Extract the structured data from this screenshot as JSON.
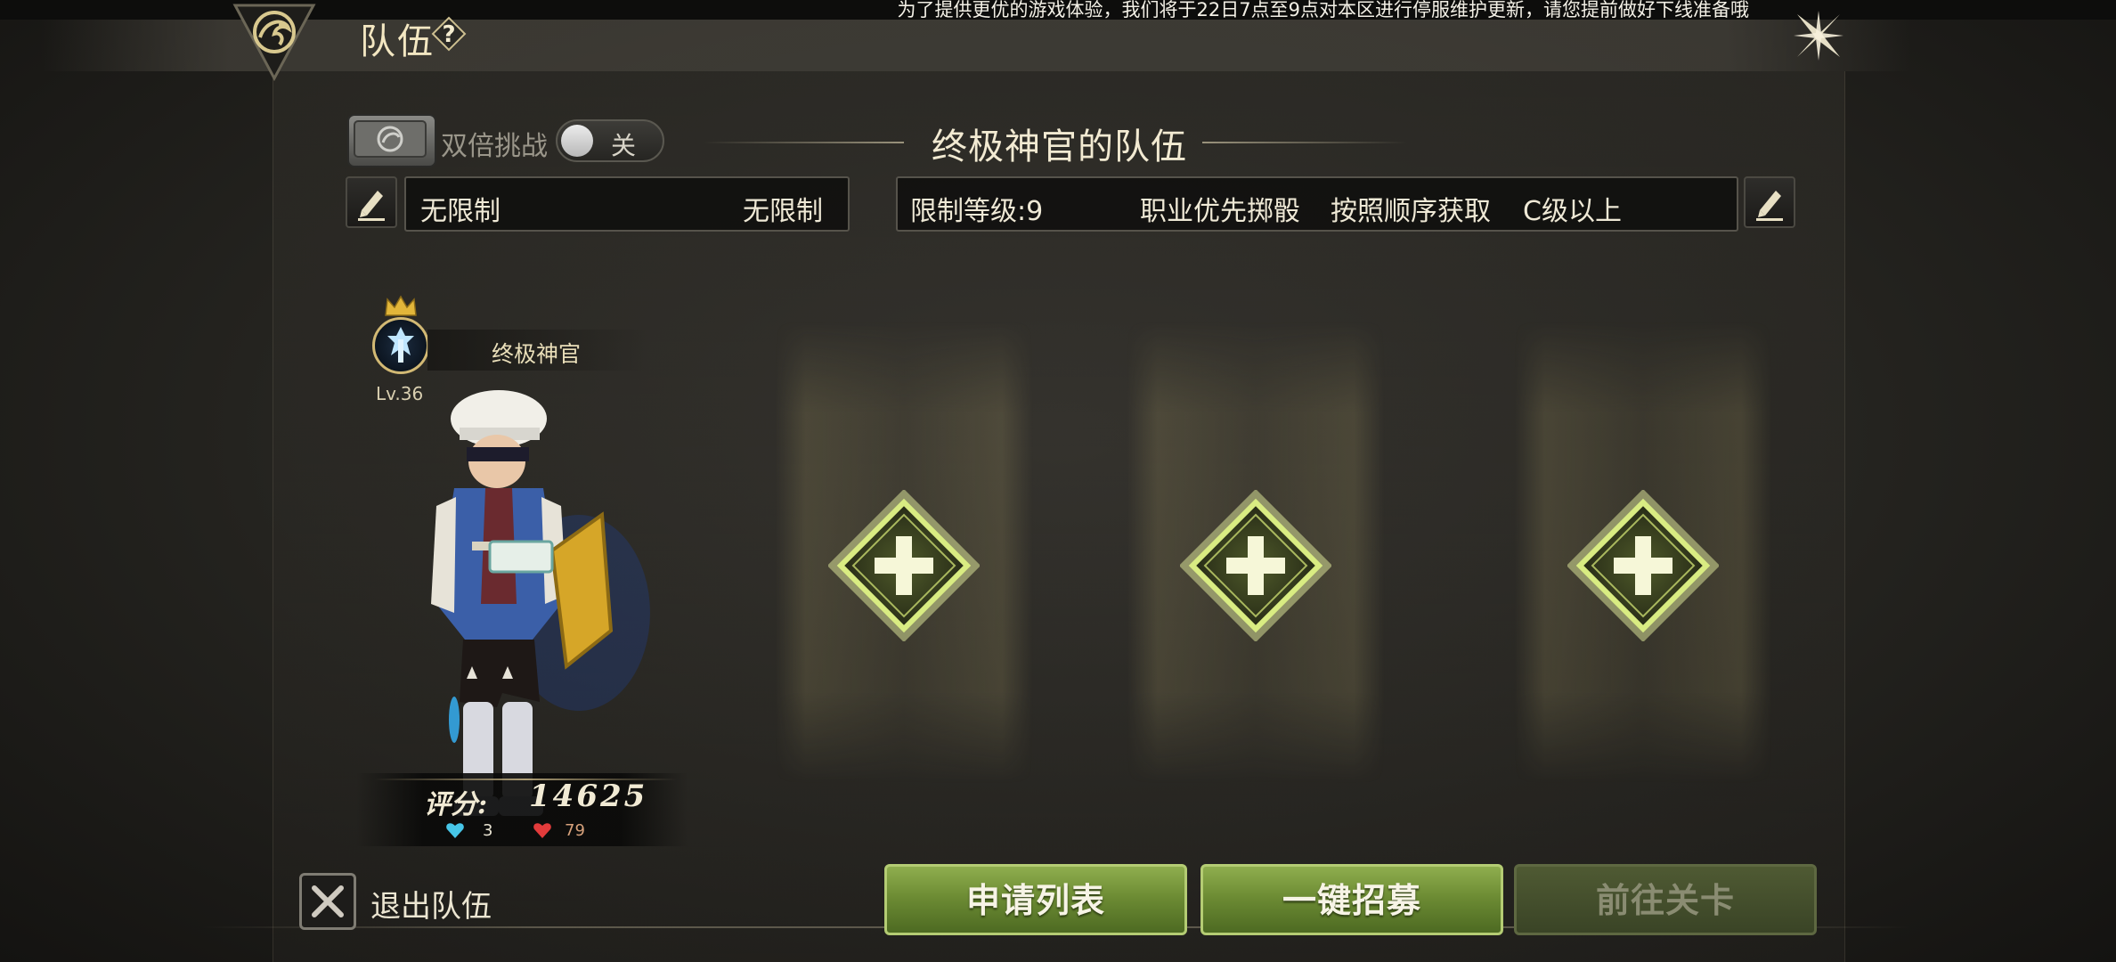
{
  "notice": "为了提供更优的游戏体验，我们将于22日7点至9点对本区进行停服维护更新，请您提前做好下线准备哦",
  "header": {
    "title": "队伍",
    "help_glyph": "?"
  },
  "double_challenge": {
    "label": "双倍挑战",
    "toggle_state": "关"
  },
  "team": {
    "name": "终极神官的队伍",
    "left_restrictions": [
      "无限制",
      "无限制"
    ],
    "right_restrictions": [
      "限制等级:9",
      "职业优先掷骰",
      "按照顺序获取",
      "C级以上"
    ]
  },
  "member": {
    "name": "终极神官",
    "level": "Lv.36",
    "score_label": "评分:",
    "score": "14625",
    "blue_stat": "3",
    "red_stat": "79"
  },
  "empty_slots": 3,
  "footer": {
    "leave_label": "退出队伍",
    "buttons": [
      "申请列表",
      "一键招募",
      "前往关卡"
    ]
  },
  "colors": {
    "accent_gold": "#d2b974",
    "button_green": "#6d8c34",
    "button_disabled": "#3a4426"
  }
}
